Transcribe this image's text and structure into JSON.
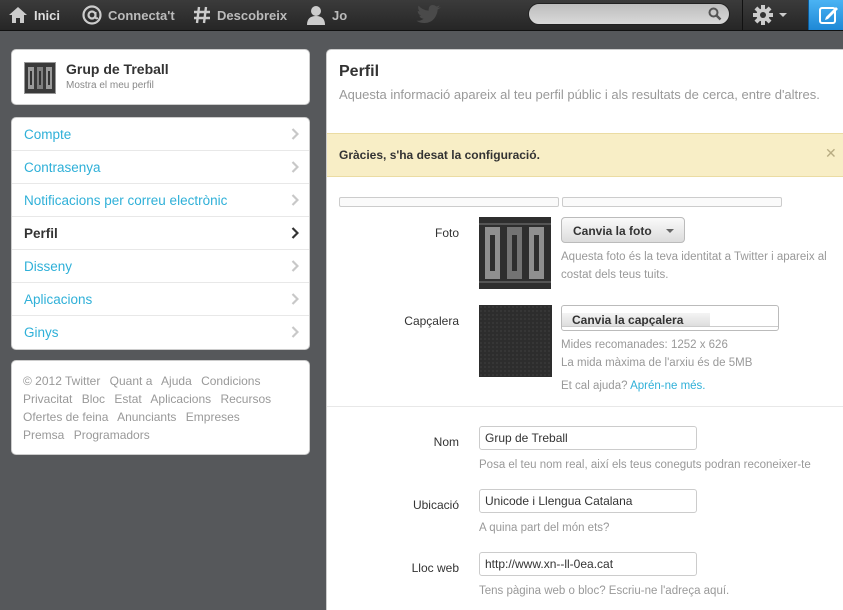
{
  "topbar": {
    "nav": [
      {
        "label": "Inici",
        "icon": "home-icon"
      },
      {
        "label": "Connecta't",
        "icon": "at-icon"
      },
      {
        "label": "Descobreix",
        "icon": "hash-icon"
      },
      {
        "label": "Jo",
        "icon": "user-icon"
      }
    ],
    "search_placeholder": "",
    "brand_icon": "twitter-bird-icon",
    "settings_icon": "gear-icon",
    "compose_icon": "compose-icon",
    "compose_color": "#2a9ae5"
  },
  "sidebar": {
    "profile": {
      "name": "Grup de Treball",
      "subtitle": "Mostra el meu perfil"
    },
    "menu": [
      {
        "label": "Compte",
        "active": false
      },
      {
        "label": "Contrasenya",
        "active": false
      },
      {
        "label": "Notificacions per correu electrònic",
        "active": false
      },
      {
        "label": "Perfil",
        "active": true
      },
      {
        "label": "Disseny",
        "active": false
      },
      {
        "label": "Aplicacions",
        "active": false
      },
      {
        "label": "Ginys",
        "active": false
      }
    ],
    "footer_links": [
      "© 2012 Twitter",
      "Quant a",
      "Ajuda",
      "Condicions",
      "Privacitat",
      "Bloc",
      "Estat",
      "Aplicacions",
      "Recursos",
      "Ofertes de feina",
      "Anunciants",
      "Empreses",
      "Premsa",
      "Programadors"
    ]
  },
  "main": {
    "title": "Perfil",
    "subtitle": "Aquesta informació apareix al teu perfil públic i als resultats de cerca, entre d'altres.",
    "alert": "Gràcies, s'ha desat la configuració.",
    "photo": {
      "label": "Foto",
      "button": "Canvia la foto",
      "help": "Aquesta foto és la teva identitat a Twitter i apareix al costat dels teus tuits."
    },
    "header": {
      "label": "Capçalera",
      "button": "Canvia la capçalera",
      "help1": "Mides recomanades: 1252 x 626",
      "help2": "La mida màxima de l'arxiu és de 5MB",
      "help3_prefix": "Et cal ajuda?",
      "help3_link": "Aprén-ne més."
    },
    "name": {
      "label": "Nom",
      "value": "Grup de Treball",
      "help": "Posa el teu nom real, així els teus coneguts podran reconeixer-te"
    },
    "location": {
      "label": "Ubicació",
      "value": "Unicode i Llengua Catalana",
      "help": "A quina part del món ets?"
    },
    "website": {
      "label": "Lloc web",
      "value": "http://www.xn--ll-0ea.cat",
      "help": "Tens pàgina web o bloc? Escriu-ne l'adreça aquí."
    }
  },
  "colors": {
    "link": "#2fb0d8",
    "alert_bg": "#f8eec6",
    "page_bg": "#56585b"
  }
}
